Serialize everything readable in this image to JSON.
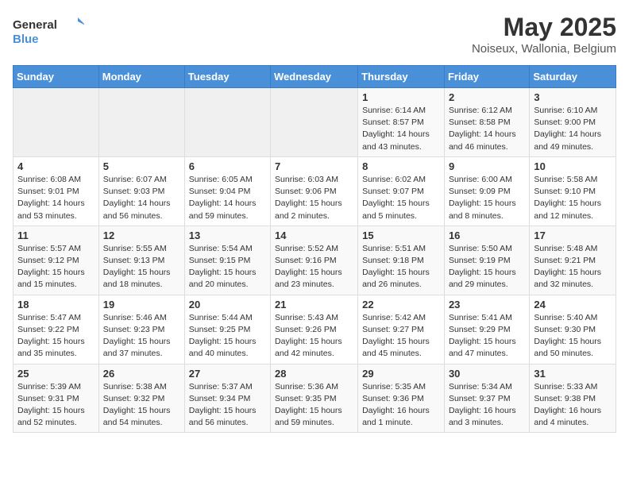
{
  "header": {
    "logo_general": "General",
    "logo_blue": "Blue",
    "month": "May 2025",
    "location": "Noiseux, Wallonia, Belgium"
  },
  "weekdays": [
    "Sunday",
    "Monday",
    "Tuesday",
    "Wednesday",
    "Thursday",
    "Friday",
    "Saturday"
  ],
  "rows": [
    [
      {
        "day": "",
        "content": ""
      },
      {
        "day": "",
        "content": ""
      },
      {
        "day": "",
        "content": ""
      },
      {
        "day": "",
        "content": ""
      },
      {
        "day": "1",
        "content": "Sunrise: 6:14 AM\nSunset: 8:57 PM\nDaylight: 14 hours\nand 43 minutes."
      },
      {
        "day": "2",
        "content": "Sunrise: 6:12 AM\nSunset: 8:58 PM\nDaylight: 14 hours\nand 46 minutes."
      },
      {
        "day": "3",
        "content": "Sunrise: 6:10 AM\nSunset: 9:00 PM\nDaylight: 14 hours\nand 49 minutes."
      }
    ],
    [
      {
        "day": "4",
        "content": "Sunrise: 6:08 AM\nSunset: 9:01 PM\nDaylight: 14 hours\nand 53 minutes."
      },
      {
        "day": "5",
        "content": "Sunrise: 6:07 AM\nSunset: 9:03 PM\nDaylight: 14 hours\nand 56 minutes."
      },
      {
        "day": "6",
        "content": "Sunrise: 6:05 AM\nSunset: 9:04 PM\nDaylight: 14 hours\nand 59 minutes."
      },
      {
        "day": "7",
        "content": "Sunrise: 6:03 AM\nSunset: 9:06 PM\nDaylight: 15 hours\nand 2 minutes."
      },
      {
        "day": "8",
        "content": "Sunrise: 6:02 AM\nSunset: 9:07 PM\nDaylight: 15 hours\nand 5 minutes."
      },
      {
        "day": "9",
        "content": "Sunrise: 6:00 AM\nSunset: 9:09 PM\nDaylight: 15 hours\nand 8 minutes."
      },
      {
        "day": "10",
        "content": "Sunrise: 5:58 AM\nSunset: 9:10 PM\nDaylight: 15 hours\nand 12 minutes."
      }
    ],
    [
      {
        "day": "11",
        "content": "Sunrise: 5:57 AM\nSunset: 9:12 PM\nDaylight: 15 hours\nand 15 minutes."
      },
      {
        "day": "12",
        "content": "Sunrise: 5:55 AM\nSunset: 9:13 PM\nDaylight: 15 hours\nand 18 minutes."
      },
      {
        "day": "13",
        "content": "Sunrise: 5:54 AM\nSunset: 9:15 PM\nDaylight: 15 hours\nand 20 minutes."
      },
      {
        "day": "14",
        "content": "Sunrise: 5:52 AM\nSunset: 9:16 PM\nDaylight: 15 hours\nand 23 minutes."
      },
      {
        "day": "15",
        "content": "Sunrise: 5:51 AM\nSunset: 9:18 PM\nDaylight: 15 hours\nand 26 minutes."
      },
      {
        "day": "16",
        "content": "Sunrise: 5:50 AM\nSunset: 9:19 PM\nDaylight: 15 hours\nand 29 minutes."
      },
      {
        "day": "17",
        "content": "Sunrise: 5:48 AM\nSunset: 9:21 PM\nDaylight: 15 hours\nand 32 minutes."
      }
    ],
    [
      {
        "day": "18",
        "content": "Sunrise: 5:47 AM\nSunset: 9:22 PM\nDaylight: 15 hours\nand 35 minutes."
      },
      {
        "day": "19",
        "content": "Sunrise: 5:46 AM\nSunset: 9:23 PM\nDaylight: 15 hours\nand 37 minutes."
      },
      {
        "day": "20",
        "content": "Sunrise: 5:44 AM\nSunset: 9:25 PM\nDaylight: 15 hours\nand 40 minutes."
      },
      {
        "day": "21",
        "content": "Sunrise: 5:43 AM\nSunset: 9:26 PM\nDaylight: 15 hours\nand 42 minutes."
      },
      {
        "day": "22",
        "content": "Sunrise: 5:42 AM\nSunset: 9:27 PM\nDaylight: 15 hours\nand 45 minutes."
      },
      {
        "day": "23",
        "content": "Sunrise: 5:41 AM\nSunset: 9:29 PM\nDaylight: 15 hours\nand 47 minutes."
      },
      {
        "day": "24",
        "content": "Sunrise: 5:40 AM\nSunset: 9:30 PM\nDaylight: 15 hours\nand 50 minutes."
      }
    ],
    [
      {
        "day": "25",
        "content": "Sunrise: 5:39 AM\nSunset: 9:31 PM\nDaylight: 15 hours\nand 52 minutes."
      },
      {
        "day": "26",
        "content": "Sunrise: 5:38 AM\nSunset: 9:32 PM\nDaylight: 15 hours\nand 54 minutes."
      },
      {
        "day": "27",
        "content": "Sunrise: 5:37 AM\nSunset: 9:34 PM\nDaylight: 15 hours\nand 56 minutes."
      },
      {
        "day": "28",
        "content": "Sunrise: 5:36 AM\nSunset: 9:35 PM\nDaylight: 15 hours\nand 59 minutes."
      },
      {
        "day": "29",
        "content": "Sunrise: 5:35 AM\nSunset: 9:36 PM\nDaylight: 16 hours\nand 1 minute."
      },
      {
        "day": "30",
        "content": "Sunrise: 5:34 AM\nSunset: 9:37 PM\nDaylight: 16 hours\nand 3 minutes."
      },
      {
        "day": "31",
        "content": "Sunrise: 5:33 AM\nSunset: 9:38 PM\nDaylight: 16 hours\nand 4 minutes."
      }
    ]
  ]
}
